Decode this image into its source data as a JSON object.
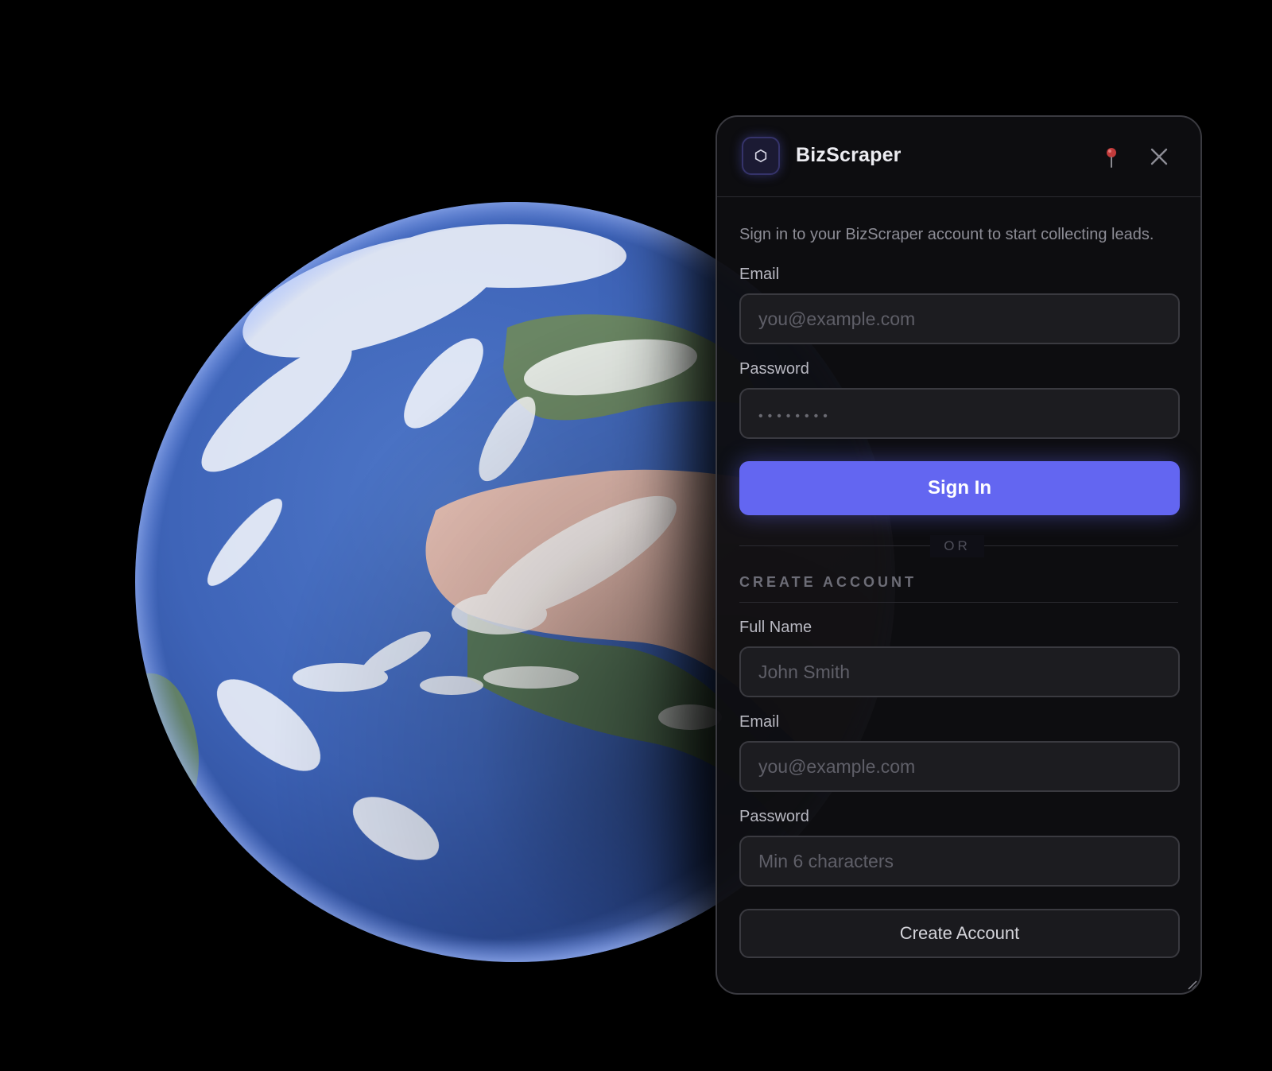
{
  "app": {
    "title": "BizScraper",
    "accent_color": "#6366f1",
    "logo_icon": "hexagon-icon",
    "pin_icon": "pin-icon",
    "close_icon": "close-icon"
  },
  "sign_in": {
    "intro": "Sign in to your BizScraper account to start collecting leads.",
    "email_label": "Email",
    "email_placeholder": "you@example.com",
    "password_label": "Password",
    "password_placeholder": "••••••••",
    "submit_label": "Sign In"
  },
  "divider": {
    "label": "OR"
  },
  "create_account": {
    "section_title": "CREATE ACCOUNT",
    "name_label": "Full Name",
    "name_placeholder": "John Smith",
    "email_label": "Email",
    "email_placeholder": "you@example.com",
    "password_label": "Password",
    "password_placeholder": "Min 6 characters",
    "submit_label": "Create Account"
  }
}
